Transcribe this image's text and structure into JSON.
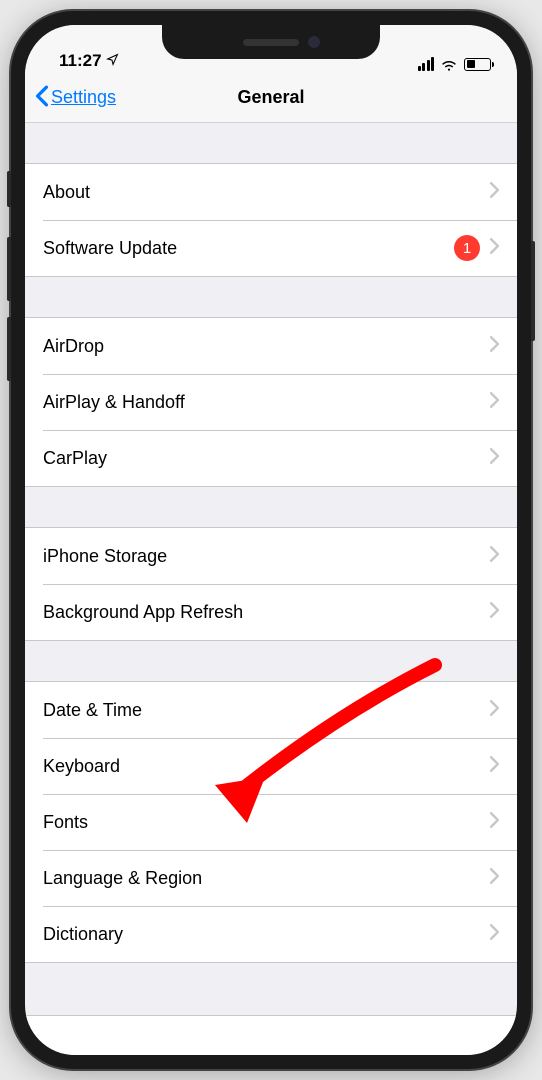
{
  "status": {
    "time": "11:27",
    "locationActive": true
  },
  "nav": {
    "backLabel": "Settings",
    "title": "General"
  },
  "groups": [
    {
      "rows": [
        {
          "label": "About",
          "badge": null
        },
        {
          "label": "Software Update",
          "badge": "1"
        }
      ]
    },
    {
      "rows": [
        {
          "label": "AirDrop",
          "badge": null
        },
        {
          "label": "AirPlay & Handoff",
          "badge": null
        },
        {
          "label": "CarPlay",
          "badge": null
        }
      ]
    },
    {
      "rows": [
        {
          "label": "iPhone Storage",
          "badge": null
        },
        {
          "label": "Background App Refresh",
          "badge": null
        }
      ]
    },
    {
      "rows": [
        {
          "label": "Date & Time",
          "badge": null
        },
        {
          "label": "Keyboard",
          "badge": null
        },
        {
          "label": "Fonts",
          "badge": null
        },
        {
          "label": "Language & Region",
          "badge": null
        },
        {
          "label": "Dictionary",
          "badge": null
        }
      ]
    }
  ],
  "annotation": {
    "target": "Keyboard",
    "arrowColor": "#ff0000"
  }
}
